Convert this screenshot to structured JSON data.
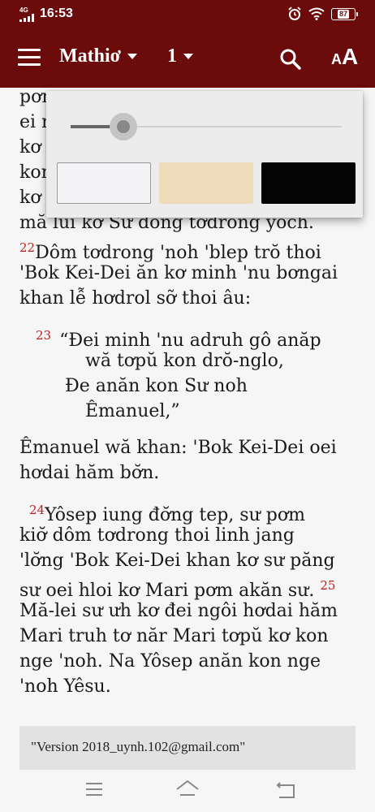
{
  "status_bar": {
    "network": "4G",
    "time": "16:53",
    "battery": "87",
    "icons": [
      "signal-icon",
      "alarm-icon",
      "wifi-icon",
      "battery-icon"
    ]
  },
  "app_bar": {
    "book": "Mathiơ",
    "chapter": "1",
    "font_small": "A",
    "font_large": "A",
    "icons": [
      "menu-icon",
      "chevron-down-icon",
      "search-icon",
      "font-size-icon"
    ]
  },
  "reader": {
    "lines_partial": [
      "pơn",
      "ei n",
      "kơ",
      "kon",
      "kơ",
      "mă lui kơ Sư dŏng tơdrong yŏch."
    ],
    "v22_num": "22",
    "v22_lines": [
      "Dôm tơdrong 'noh 'blep trŏ thoi",
      "'Bok Kei-Dei ăn kơ minh 'nu bơngai",
      "khan lễ hơdrol sỡ thoi âu:"
    ],
    "v23_num": "23",
    "v23_lines": [
      "“Đei minh 'nu adruh gô anăp",
      "wă tơpŭ kon drŏ-nglo,",
      "Đe anăn kon Sư noh",
      "Êmanuel,”"
    ],
    "note_lines": [
      "Êmanuel wă khan: 'Bok Kei-Dei oei",
      "hơdai hăm bơ̆n."
    ],
    "v24_num": "24",
    "v25_num": "25",
    "v24_lines": [
      "Yôsep iung đơ̆ng tep, sư pơm",
      "kiơ̆ dôm tơdrong thoi linh jang",
      "'lơ̆ng 'Bok Kei-Dei khan kơ sư păng",
      "sư oei hloi kơ Mari pơm akăn sư.",
      "Mă-lei sư ưh kơ đei ngôi hơdai hăm",
      "Mari truh tơ năr Mari tơpŭ kơ kon",
      "nge 'noh. Na Yôsep anăn kon nge",
      "'noh Yêsu."
    ],
    "version": "\"Version 2018_uynh.102@gmail.com\""
  },
  "display_popup": {
    "font_size_level": 0.15,
    "themes": [
      {
        "name": "white",
        "color": "#f4f4f6"
      },
      {
        "name": "sepia",
        "color": "#eedcba"
      },
      {
        "name": "black",
        "color": "#040404"
      }
    ]
  },
  "nav_bar": {
    "icons": [
      "recent-apps-icon",
      "home-icon",
      "back-icon"
    ]
  },
  "colors": {
    "brand": "#6b0b0b",
    "verse_number": "#c02020",
    "background": "#f6f6f6"
  }
}
